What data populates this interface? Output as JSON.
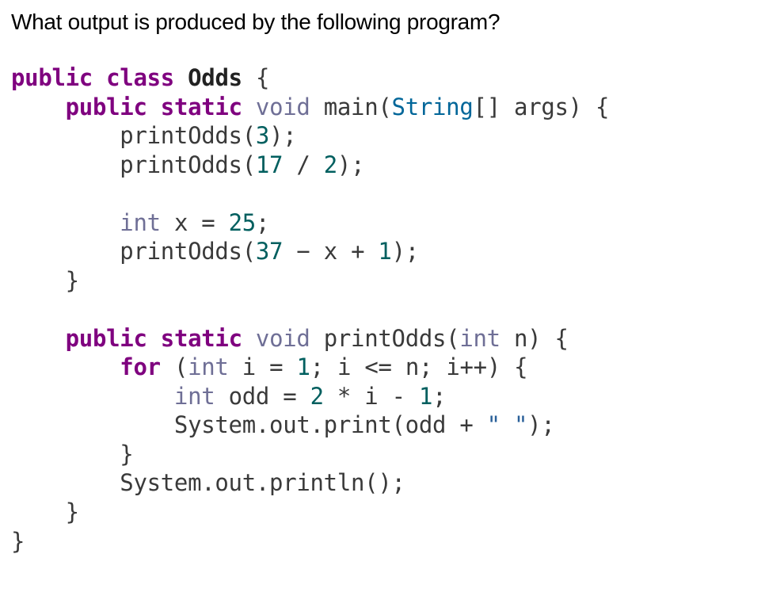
{
  "question": "What output is produced by the following program?",
  "code": {
    "kw_public": "public",
    "kw_class": "class",
    "kw_static": "static",
    "kw_void": "void",
    "kw_for": "for",
    "kw_int": "int",
    "type_string": "String",
    "class_name": "Odds",
    "method_main": "main",
    "method_printOdds": "printOdds",
    "arg_args": "args",
    "var_x": "x",
    "var_n": "n",
    "var_i": "i",
    "var_odd": "odd",
    "num_3": "3",
    "num_17": "17",
    "num_2": "2",
    "num_25": "25",
    "num_37": "37",
    "num_1": "1",
    "sys_out_print": "System.out.print",
    "sys_out_println": "System.out.println",
    "str_space": "\" \"",
    "p_open_curly": "{",
    "p_close_curly": "}",
    "p_open_paren": "(",
    "p_close_paren": ")",
    "p_open_bracket": "[",
    "p_close_bracket": "]",
    "p_semi": ";",
    "p_eq": "=",
    "p_lte": "<=",
    "p_plusplus": "++",
    "p_div": "/",
    "p_minus": "−",
    "p_minus2": "-",
    "p_plus": "+",
    "p_star": "*",
    "p_empty_parens": "()"
  }
}
